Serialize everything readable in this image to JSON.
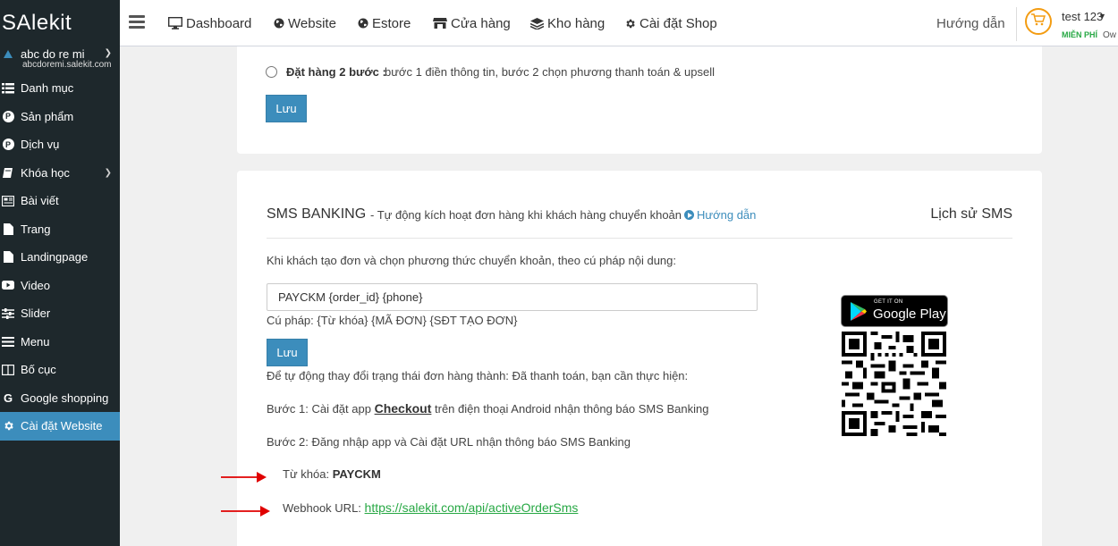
{
  "brand": {
    "logo_text": "SAlekit"
  },
  "site": {
    "name": "abc do re mi",
    "domain": "abcdoremi.salekit.com"
  },
  "sidebar": {
    "items": [
      {
        "label": "Danh mục",
        "icon": "list-icon",
        "has_arrow": false
      },
      {
        "label": "Sản phẩm",
        "icon": "product-p-icon",
        "has_arrow": false
      },
      {
        "label": "Dịch vụ",
        "icon": "service-p-icon",
        "has_arrow": false
      },
      {
        "label": "Khóa học",
        "icon": "book-icon",
        "has_arrow": true
      },
      {
        "label": "Bài viết",
        "icon": "newspaper-icon",
        "has_arrow": false
      },
      {
        "label": "Trang",
        "icon": "file-icon",
        "has_arrow": false
      },
      {
        "label": "Landingpage",
        "icon": "file-icon",
        "has_arrow": false
      },
      {
        "label": "Video",
        "icon": "youtube-icon",
        "has_arrow": false
      },
      {
        "label": "Slider",
        "icon": "sliders-icon",
        "has_arrow": false
      },
      {
        "label": "Menu",
        "icon": "bars-icon",
        "has_arrow": false
      },
      {
        "label": "Bố cục",
        "icon": "columns-icon",
        "has_arrow": false
      },
      {
        "label": "Google shopping",
        "icon": "google-icon",
        "has_arrow": false
      },
      {
        "label": "Cài đặt Website",
        "icon": "gear-icon",
        "has_arrow": false,
        "active": true
      }
    ]
  },
  "header": {
    "nav": [
      {
        "label": "Dashboard",
        "icon": "desktop-icon"
      },
      {
        "label": "Website",
        "icon": "globe-icon"
      },
      {
        "label": "Estore",
        "icon": "globe-icon"
      },
      {
        "label": "Cửa hàng",
        "icon": "store-icon"
      },
      {
        "label": "Kho hàng",
        "icon": "layers-icon"
      },
      {
        "label": "Cài đặt Shop",
        "icon": "gear-icon"
      }
    ],
    "guide": "Hướng dẫn",
    "user": {
      "name": "test 123",
      "plan": "MIỄN PHÍ",
      "role": "Ow"
    }
  },
  "order_option": {
    "label_bold": "Đặt hàng 2 bước :",
    "label_text": "bước 1 điền thông tin, bước 2 chọn phương thanh toán & upsell",
    "save_label": "Lưu"
  },
  "sms": {
    "title": "SMS BANKING",
    "subtitle": "- Tự động kích hoạt đơn hàng khi khách hàng chuyển khoản",
    "help_link": "Hướng dẫn",
    "history": "Lịch sử SMS",
    "intro": "Khi khách tạo đơn và chọn phương thức chuyển khoản, theo cú pháp nội dung:",
    "syntax_value": "PAYCKM {order_id} {phone}",
    "syntax_hint": "Cú pháp: {Từ khóa} {MÃ ĐƠN} {SĐT TẠO ĐƠN}",
    "save_label": "Lưu",
    "auto_text": "Để tự động thay đổi trạng thái đơn hàng thành: Đã thanh toán, bạn cần thực hiện:",
    "step1_prefix": "Bước 1: Cài đặt app",
    "step1_link": "Checkout",
    "step1_suffix": "trên điện thoại Android nhận thông báo SMS Banking",
    "step2": "Bước 2: Đăng nhập app và Cài đặt URL nhận thông báo SMS Banking",
    "keyword_label": "Từ khóa:",
    "keyword_value": "PAYCKM",
    "webhook_label": "Webhook URL:",
    "webhook_url": "https://salekit.com/api/activeOrderSms",
    "gplay_small": "GET IT ON",
    "gplay_big": "Google Play"
  },
  "colors": {
    "sidebar_bg": "#1e282c",
    "accent": "#3c8dbc",
    "link_green": "#27a844",
    "arrow_red": "#e00000",
    "cart_orange": "#f39c12"
  }
}
